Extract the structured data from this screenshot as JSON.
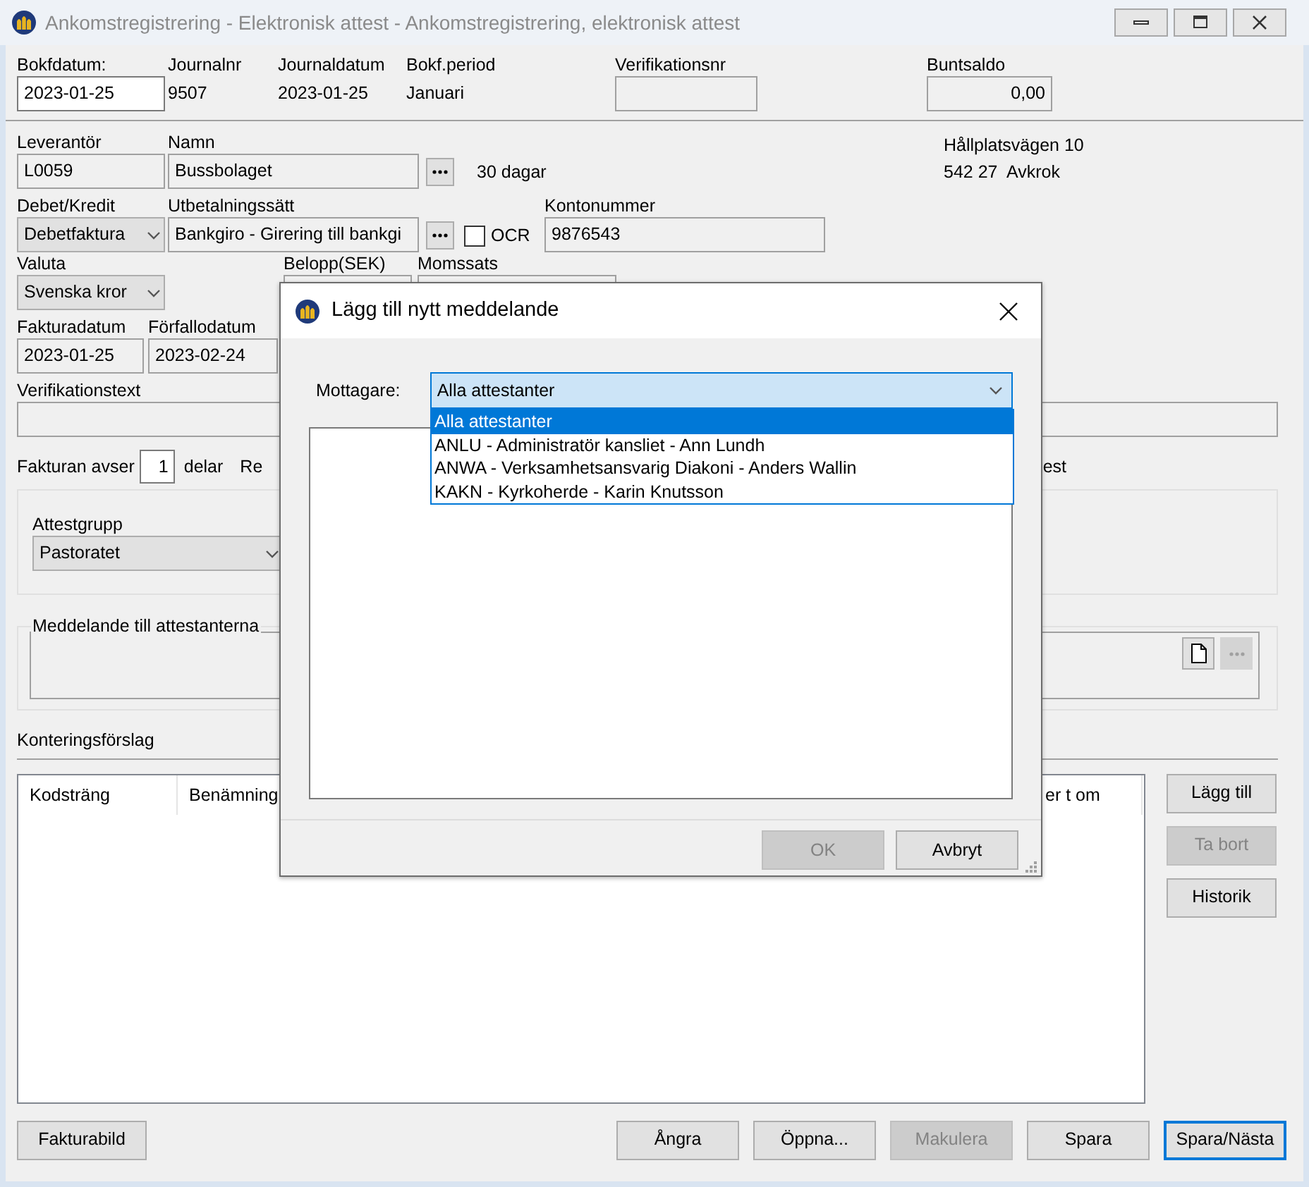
{
  "window": {
    "title": "Ankomstregistrering - Elektronisk attest - Ankomstregistrering, elektronisk attest"
  },
  "header_fields": [
    {
      "label": "Bokfdatum:",
      "value": "2023-01-25",
      "kind": "input"
    },
    {
      "label": "Journalnr",
      "value": "9507",
      "kind": "text"
    },
    {
      "label": "Journaldatum",
      "value": "2023-01-25",
      "kind": "text"
    },
    {
      "label": "Bokf.period",
      "value": "Januari",
      "kind": "text"
    },
    {
      "label": "Verifikationsnr",
      "kind": "readonly"
    },
    {
      "label": "Buntsaldo",
      "value": "0,00",
      "kind": "readonly"
    }
  ],
  "supplier": {
    "leverantor_label": "Leverantör",
    "leverantor": "L0059",
    "namn_label": "Namn",
    "namn": "Bussbolaget",
    "terms": "30 dagar",
    "address": [
      "Hållplatsvägen 10",
      "542 27  Avkrok"
    ]
  },
  "payment": {
    "debet_kredit_label": "Debet/Kredit",
    "debet_kredit": "Debetfaktura",
    "utbetalning_label": "Utbetalningssätt",
    "utbetalning": "Bankgiro - Girering till bankgi",
    "ocr_label": "OCR",
    "ocr_checked": false,
    "kontonummer_label": "Kontonummer",
    "kontonummer": "9876543"
  },
  "amounts": {
    "valuta_label": "Valuta",
    "valuta": "Svenska kror",
    "belopp_label": "Belopp(SEK)",
    "momssats_label": "Momssats"
  },
  "dates": {
    "fakturadatum_label": "Fakturadatum",
    "fakturadatum": "2023-01-25",
    "forfallodatum_label": "Förfallodatum",
    "forfallodatum": "2023-02-24"
  },
  "verifikationstext_label": "Verifikationstext",
  "parts": {
    "prefix": "Fakturan avser",
    "count": "1",
    "suffix": "delar",
    "partial_left": "Re",
    "partial_right": "est"
  },
  "attest": {
    "label": "Attestgrupp",
    "value": "Pastoratet"
  },
  "message_group": {
    "label": "Meddelande till attestanterna"
  },
  "kontering": {
    "title": "Konteringsförslag",
    "columns": [
      "Kodsträng",
      "Benämning",
      "er t om"
    ]
  },
  "side_buttons": [
    {
      "label": "Lägg till",
      "disabled": false
    },
    {
      "label": "Ta bort",
      "disabled": true
    },
    {
      "label": "Historik",
      "disabled": false
    }
  ],
  "bottom_left_button": {
    "label": "Fakturabild",
    "disabled": false,
    "default": false
  },
  "bottom_buttons": [
    {
      "label": "Ångra",
      "disabled": false,
      "default": false
    },
    {
      "label": "Öppna...",
      "disabled": false,
      "default": false
    },
    {
      "label": "Makulera",
      "disabled": true,
      "default": false
    },
    {
      "label": "Spara",
      "disabled": false,
      "default": false
    },
    {
      "label": "Spara/Nästa",
      "disabled": false,
      "default": true
    }
  ],
  "dialog": {
    "title": "Lägg till nytt meddelande",
    "recipient_label": "Mottagare:",
    "recipient": "Alla attestanter",
    "options": [
      {
        "label": "Alla attestanter",
        "selected": true
      },
      {
        "label": "ANLU - Administratör kansliet - Ann Lundh",
        "selected": false
      },
      {
        "label": "ANWA - Verksamhetsansvarig Diakoni - Anders Wallin",
        "selected": false
      },
      {
        "label": "KAKN - Kyrkoherde - Karin Knutsson",
        "selected": false
      }
    ],
    "buttons": [
      {
        "label": "OK",
        "disabled": true
      },
      {
        "label": "Avbryt",
        "disabled": false
      }
    ]
  }
}
